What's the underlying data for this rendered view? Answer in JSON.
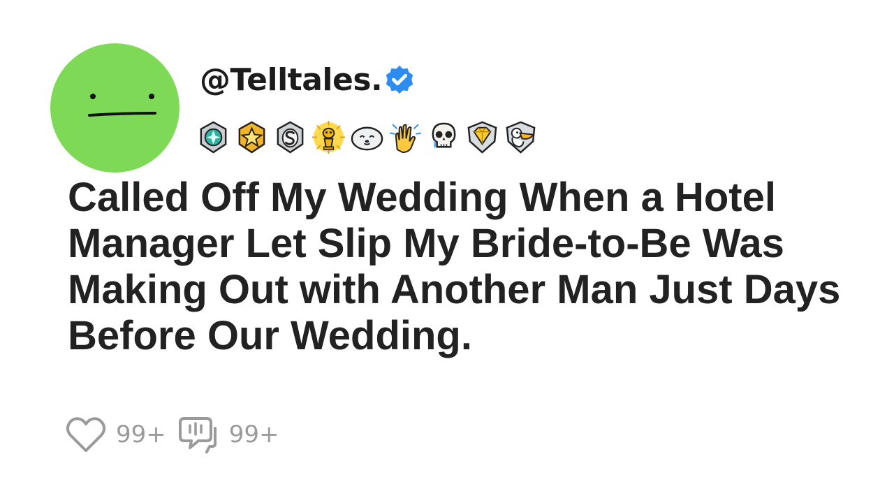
{
  "post": {
    "username": "@Telltales.",
    "verified": true,
    "title": "Called Off My Wedding When a Hotel Manager Let Slip My Bride-to-Be Was Making Out with Another Man Just Days Before Our Wedding."
  },
  "avatar": {
    "color": "#7ed957",
    "face": "neutral-face"
  },
  "badges": [
    "teal-gem-badge-icon",
    "gold-star-badge-icon",
    "silver-s-badge-icon",
    "gold-alien-trophy-icon",
    "smiling-seal-icon",
    "clapping-hands-icon",
    "crying-skull-icon",
    "gold-diamond-shield-icon",
    "pelican-shield-icon"
  ],
  "stats": {
    "likes": "99+",
    "comments": "99+"
  },
  "colors": {
    "avatar": "#7ed957",
    "verified": "#2d8cf0",
    "stat_text": "#9a9a9a",
    "title_text": "#222222"
  }
}
